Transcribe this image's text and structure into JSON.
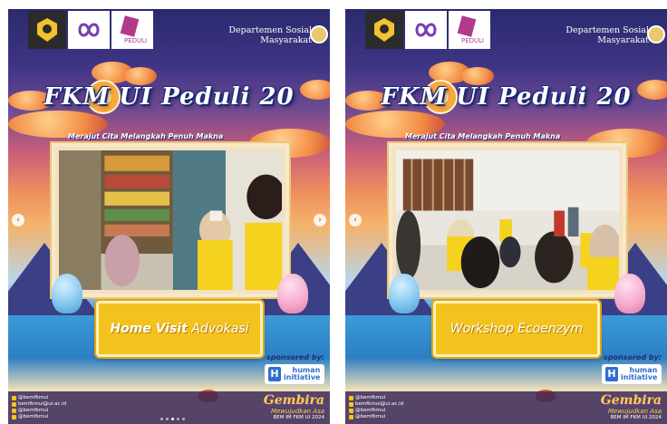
{
  "slides": [
    {
      "dept": [
        "Departemen Sosial",
        "Masyarakat"
      ],
      "title": "FKM UI Peduli 20",
      "tagline": "Merajut Cita Melangkah Penuh Makna",
      "label_prefix": "Home Visit",
      "label_main": "Advokasi",
      "sponsored_by": "sponsored by:",
      "sponsor_name": [
        "human",
        "initiative"
      ],
      "socials": [
        "@bemfkmui",
        "bemfkmui@ui.ac.id",
        "@bemfkmui",
        "@bemfkmui"
      ],
      "gembira_title": "Gembira",
      "gembira_sub": "Mewujudkan Asa",
      "bem_text": "BEM IM FKM UI 2024",
      "logo_peduli": "PEDULI"
    },
    {
      "dept": [
        "Departemen Sosial",
        "Masyarakat"
      ],
      "title": "FKM UI Peduli 20",
      "tagline": "Merajut Cita Melangkah Penuh Makna",
      "label_prefix": "",
      "label_main": "Workshop Ecoenzym",
      "sponsored_by": "sponsored by:",
      "sponsor_name": [
        "human",
        "initiative"
      ],
      "socials": [
        "@bemfkmui",
        "bemfkmui@ui.ac.id",
        "@bemfkmui",
        "@bemfkmui"
      ],
      "gembira_title": "Gembira",
      "gembira_sub": "Mewujudkan Asa",
      "bem_text": "BEM IM FKM UI 2024",
      "logo_peduli": "PEDULI"
    }
  ],
  "icons": {
    "prev": "chevron-left-icon",
    "next": "chevron-right-icon"
  },
  "nav": {
    "prev_glyph": "‹",
    "next_glyph": "›"
  }
}
